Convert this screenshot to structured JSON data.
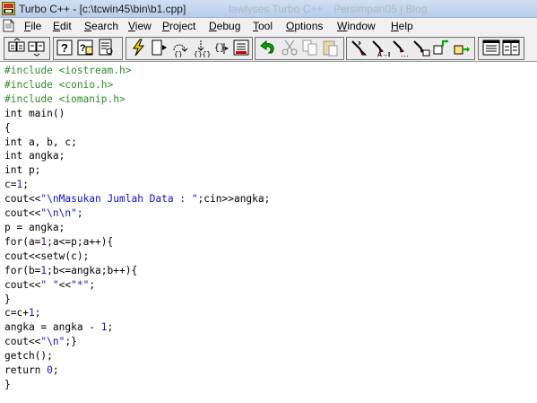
{
  "window": {
    "title": "Turbo C++ - [c:\\tcwin45\\bin\\b1.cpp]",
    "ghost_text_1": "lawlyses Turbo C++",
    "ghost_text_2": "Persimpan05 | Blog"
  },
  "menu": {
    "items": [
      {
        "id": "file",
        "label": "File",
        "accel": "F"
      },
      {
        "id": "edit",
        "label": "Edit",
        "accel": "E"
      },
      {
        "id": "search",
        "label": "Search",
        "accel": "S"
      },
      {
        "id": "view",
        "label": "View",
        "accel": "V"
      },
      {
        "id": "project",
        "label": "Project",
        "accel": "P"
      },
      {
        "id": "debug",
        "label": "Debug",
        "accel": "D"
      },
      {
        "id": "tool",
        "label": "Tool",
        "accel": "T"
      },
      {
        "id": "options",
        "label": "Options",
        "accel": "O"
      },
      {
        "id": "window",
        "label": "Window",
        "accel": "W"
      },
      {
        "id": "help",
        "label": "Help",
        "accel": "H"
      }
    ]
  },
  "toolbar": {
    "buttons": [
      {
        "id": "open-project",
        "icon": "open-project-icon"
      },
      {
        "id": "close-project",
        "icon": "close-project-icon"
      },
      {
        "id": "help",
        "icon": "help-icon"
      },
      {
        "id": "help-topic",
        "icon": "help-topic-icon"
      },
      {
        "id": "search",
        "icon": "search-icon"
      },
      {
        "id": "search-again",
        "icon": "search-again-icon"
      },
      {
        "id": "make",
        "icon": "lightning-icon"
      },
      {
        "id": "run",
        "icon": "run-icon"
      },
      {
        "id": "step-over",
        "icon": "step-over-icon"
      },
      {
        "id": "trace-into",
        "icon": "trace-into-icon"
      },
      {
        "id": "run-to-cursor",
        "icon": "run-to-cursor-icon"
      },
      {
        "id": "toggle-breakpoint",
        "icon": "breakpoint-icon"
      },
      {
        "id": "undo",
        "icon": "undo-icon"
      },
      {
        "id": "cut",
        "icon": "cut-icon"
      },
      {
        "id": "copy",
        "icon": "copy-icon"
      },
      {
        "id": "paste",
        "icon": "paste-icon"
      },
      {
        "id": "compile",
        "icon": "compile-icon"
      },
      {
        "id": "replace",
        "icon": "replace-icon"
      },
      {
        "id": "find-next",
        "icon": "find-next-icon"
      },
      {
        "id": "find-prev",
        "icon": "find-prev-icon"
      },
      {
        "id": "goto-mark",
        "icon": "goto-mark-icon"
      },
      {
        "id": "goto-next",
        "icon": "goto-next-icon"
      },
      {
        "id": "list-view",
        "icon": "list-view-icon"
      },
      {
        "id": "grid-view",
        "icon": "grid-view-icon"
      }
    ]
  },
  "editor": {
    "filename": "b1.cpp",
    "lines": [
      [
        {
          "t": "#include <iostream.h>",
          "c": "pp"
        }
      ],
      [
        {
          "t": "#include <conio.h>",
          "c": "pp"
        }
      ],
      [
        {
          "t": "#include <iomanip.h>",
          "c": "pp"
        }
      ],
      [
        {
          "t": "int main()",
          "c": ""
        }
      ],
      [
        {
          "t": "{",
          "c": ""
        }
      ],
      [
        {
          "t": "int a, b, c;",
          "c": ""
        }
      ],
      [
        {
          "t": "int angka;",
          "c": ""
        }
      ],
      [
        {
          "t": "int p;",
          "c": ""
        }
      ],
      [
        {
          "t": "c=",
          "c": ""
        },
        {
          "t": "1",
          "c": "num"
        },
        {
          "t": ";",
          "c": ""
        }
      ],
      [
        {
          "t": "cout<<",
          "c": ""
        },
        {
          "t": "\"\\nMasukan Jumlah Data : \"",
          "c": "str"
        },
        {
          "t": ";cin>>angka;",
          "c": ""
        }
      ],
      [
        {
          "t": "cout<<",
          "c": ""
        },
        {
          "t": "\"\\n\\n\"",
          "c": "str"
        },
        {
          "t": ";",
          "c": ""
        }
      ],
      [
        {
          "t": "p = angka;",
          "c": ""
        }
      ],
      [
        {
          "t": "for(a=",
          "c": ""
        },
        {
          "t": "1",
          "c": "num"
        },
        {
          "t": ";a<=p;a++){",
          "c": ""
        }
      ],
      [
        {
          "t": "cout<<setw(c);",
          "c": ""
        }
      ],
      [
        {
          "t": "for(b=",
          "c": ""
        },
        {
          "t": "1",
          "c": "num"
        },
        {
          "t": ";b<=angka;b++){",
          "c": ""
        }
      ],
      [
        {
          "t": "cout<<",
          "c": ""
        },
        {
          "t": "\" \"",
          "c": "str"
        },
        {
          "t": "<<",
          "c": ""
        },
        {
          "t": "\"*\"",
          "c": "str"
        },
        {
          "t": ";",
          "c": ""
        }
      ],
      [
        {
          "t": "}",
          "c": ""
        }
      ],
      [
        {
          "t": "c=c+",
          "c": ""
        },
        {
          "t": "1",
          "c": "num"
        },
        {
          "t": ";",
          "c": ""
        }
      ],
      [
        {
          "t": "angka = angka - ",
          "c": ""
        },
        {
          "t": "1",
          "c": "num"
        },
        {
          "t": ";",
          "c": ""
        }
      ],
      [
        {
          "t": "cout<<",
          "c": ""
        },
        {
          "t": "\"\\n\"",
          "c": "str"
        },
        {
          "t": ";}",
          "c": ""
        }
      ],
      [
        {
          "t": "getch();",
          "c": ""
        }
      ],
      [
        {
          "t": "return ",
          "c": ""
        },
        {
          "t": "0",
          "c": "num"
        },
        {
          "t": ";",
          "c": ""
        }
      ],
      [
        {
          "t": "}",
          "c": ""
        }
      ]
    ]
  },
  "colors": {
    "preprocessor": "#2e8b2e",
    "string": "#1111cc",
    "number": "#1111cc",
    "text": "#000000"
  }
}
